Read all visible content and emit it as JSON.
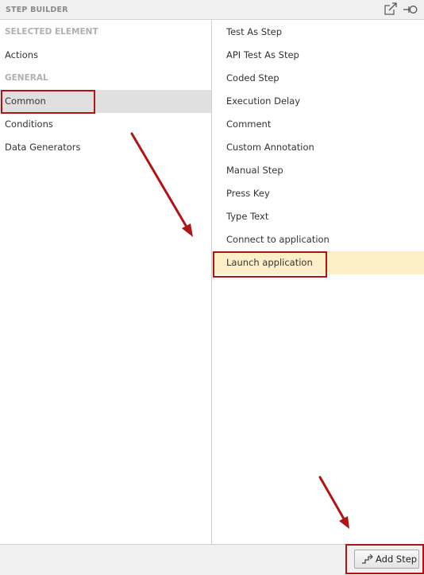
{
  "window": {
    "title": "STEP BUILDER",
    "icons": [
      "pop-out-icon",
      "pin-icon"
    ]
  },
  "left_panel": {
    "items": [
      {
        "label": "SELECTED ELEMENT",
        "kind": "header"
      },
      {
        "label": "Actions",
        "kind": "item"
      },
      {
        "label": "GENERAL",
        "kind": "header"
      },
      {
        "label": "Common",
        "kind": "item",
        "selected": true
      },
      {
        "label": "Conditions",
        "kind": "item"
      },
      {
        "label": "Data Generators",
        "kind": "item"
      }
    ]
  },
  "right_panel": {
    "items": [
      {
        "label": "Test As Step"
      },
      {
        "label": "API Test As Step"
      },
      {
        "label": "Coded Step"
      },
      {
        "label": "Execution Delay"
      },
      {
        "label": "Comment"
      },
      {
        "label": "Custom Annotation"
      },
      {
        "label": "Manual Step"
      },
      {
        "label": "Press Key"
      },
      {
        "label": "Type Text"
      },
      {
        "label": "Connect to application"
      },
      {
        "label": "Launch application",
        "selected": true
      }
    ]
  },
  "footer": {
    "add_step_label": "Add Step",
    "add_step_icon": "steps-icon"
  },
  "colors": {
    "annotation": "#b01414",
    "selected_left_bg": "#e0e0e0",
    "selected_right_bg": "#fdf0c8",
    "section_header": "#b0b0b0"
  }
}
